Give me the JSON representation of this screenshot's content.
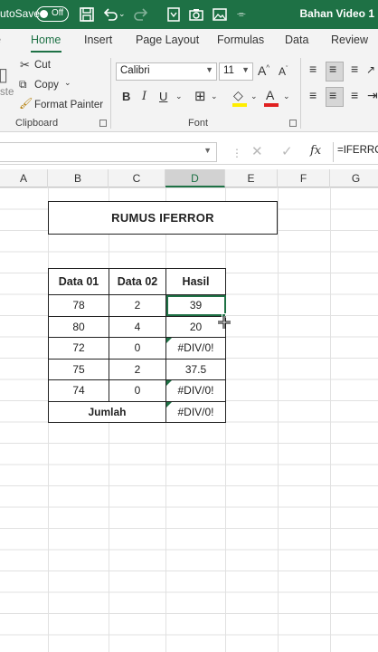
{
  "titlebar": {
    "autosave_label": "utoSave",
    "toggle_label": "Off",
    "document_title": "Bahan Video 1"
  },
  "tabs": [
    "Home",
    "Insert",
    "Page Layout",
    "Formulas",
    "Data",
    "Review"
  ],
  "active_tab": "Home",
  "ribbon": {
    "clipboard": {
      "cut": "Cut",
      "copy": "Copy",
      "format_painter": "Format Painter",
      "paste_partial": "ste",
      "group_label": "Clipboard"
    },
    "font": {
      "font_name": "Calibri",
      "font_size": "11",
      "group_label": "Font"
    }
  },
  "formula_bar": {
    "name_box": "",
    "formula": "=IFERROR("
  },
  "columns": [
    "A",
    "B",
    "C",
    "D",
    "E",
    "F",
    "G"
  ],
  "selected_column": "D",
  "sheet": {
    "title": "RUMUS IFERROR",
    "headers": [
      "Data 01",
      "Data 02",
      "Hasil"
    ],
    "rows": [
      {
        "a": "78",
        "b": "2",
        "result": "39"
      },
      {
        "a": "80",
        "b": "4",
        "result": "20"
      },
      {
        "a": "72",
        "b": "0",
        "result": "#DIV/0!"
      },
      {
        "a": "75",
        "b": "2",
        "result": "37.5"
      },
      {
        "a": "74",
        "b": "0",
        "result": "#DIV/0!"
      }
    ],
    "total_label": "Jumlah",
    "total_value": "#DIV/0!"
  },
  "colors": {
    "accent": "#1e7145",
    "titlebar_bg": "#1e7145"
  }
}
